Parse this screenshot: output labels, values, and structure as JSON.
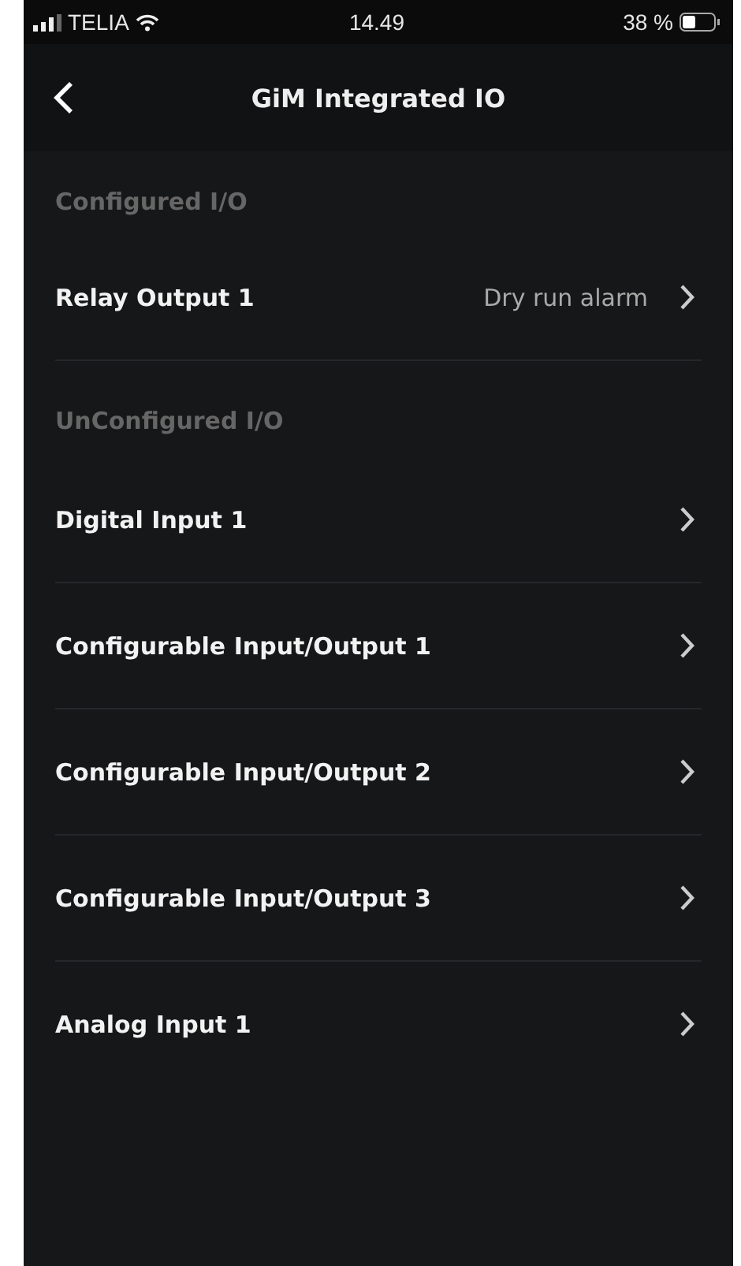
{
  "status_bar": {
    "carrier": "TELIA",
    "time": "14.49",
    "battery": "38 %"
  },
  "nav_bar": {
    "title": "GiM Integrated IO"
  },
  "sections": [
    {
      "title": "Configured I/O",
      "items": [
        {
          "label": "Relay Output 1",
          "value": "Dry run alarm"
        }
      ]
    },
    {
      "title": "UnConfigured I/O",
      "items": [
        {
          "label": "Digital Input 1"
        },
        {
          "label": "Configurable Input/Output 1"
        },
        {
          "label": "Configurable Input/Output 2"
        },
        {
          "label": "Configurable Input/Output 3"
        },
        {
          "label": "Analog Input 1"
        }
      ]
    }
  ]
}
